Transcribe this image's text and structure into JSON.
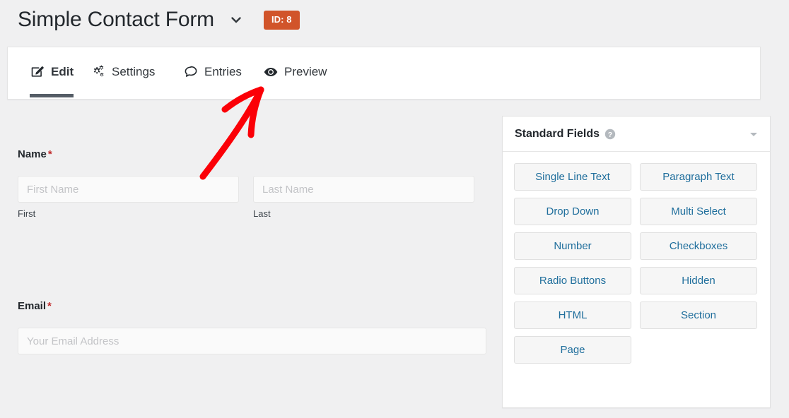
{
  "header": {
    "form_title": "Simple Contact Form",
    "chevron_icon": "chevron-down-icon",
    "id_badge": "ID: 8",
    "id_badge_color": "#d1542a"
  },
  "tabs": [
    {
      "id": "edit",
      "label": "Edit",
      "icon": "pencil-square-icon",
      "active": true
    },
    {
      "id": "settings",
      "label": "Settings",
      "icon": "gears-icon",
      "active": false
    },
    {
      "id": "entries",
      "label": "Entries",
      "icon": "speech-bubble-icon",
      "active": false
    },
    {
      "id": "preview",
      "label": "Preview",
      "icon": "eye-icon",
      "active": false
    }
  ],
  "form_fields": [
    {
      "label": "Name",
      "required_marker": "*",
      "inputs": [
        {
          "placeholder": "First Name",
          "value": "",
          "sub_label": "First"
        },
        {
          "placeholder": "Last Name",
          "value": "",
          "sub_label": "Last"
        }
      ]
    },
    {
      "label": "Email",
      "required_marker": "*",
      "inputs": [
        {
          "placeholder": "Your Email Address",
          "value": "",
          "sub_label": ""
        }
      ]
    }
  ],
  "standard_fields_panel": {
    "title": "Standard Fields",
    "help_icon": "question-mark-circle-icon",
    "toggle_icon": "caret-down-icon",
    "buttons": [
      "Single Line Text",
      "Paragraph Text",
      "Drop Down",
      "Multi Select",
      "Number",
      "Checkboxes",
      "Radio Buttons",
      "Hidden",
      "HTML",
      "Section",
      "Page"
    ],
    "button_text_color": "#1f6e9c"
  },
  "annotation": {
    "type": "arrow",
    "color": "#fb0007",
    "points_to": "Preview"
  }
}
